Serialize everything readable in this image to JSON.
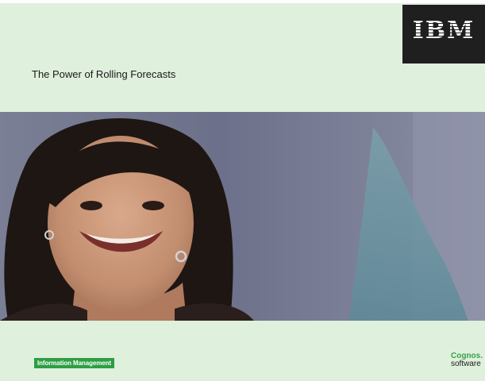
{
  "header": {
    "brand_logo_text": "IBM",
    "title": "The Power of Rolling Forecasts"
  },
  "footer": {
    "badge_label": "Information Management",
    "product_brand": "Cognos.",
    "product_sub": "software"
  },
  "colors": {
    "background": "#dff0dc",
    "logo_box": "#1f1f1f",
    "badge_green": "#2e9e44",
    "cognos_green": "#3aa04a"
  }
}
